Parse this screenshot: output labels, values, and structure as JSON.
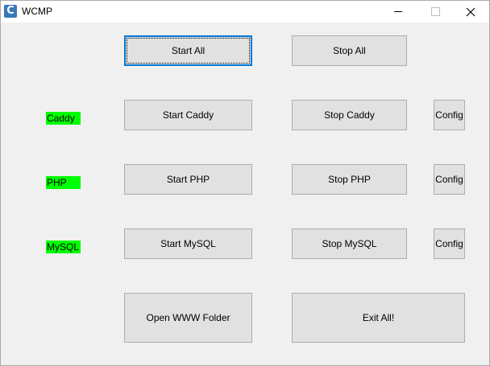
{
  "window": {
    "title": "WCMP",
    "icon_glyph": "C"
  },
  "colors": {
    "status_running": "#00ff00",
    "button_face": "#e1e1e1",
    "focus_border": "#0078d7"
  },
  "global": {
    "start_all": "Start All",
    "stop_all": "Stop All"
  },
  "services": [
    {
      "status": "Caddy",
      "start": "Start Caddy",
      "stop": "Stop Caddy",
      "config": "Config"
    },
    {
      "status": "PHP",
      "start": "Start PHP",
      "stop": "Stop PHP",
      "config": "Config"
    },
    {
      "status": "MySQL",
      "start": "Start MySQL",
      "stop": "Stop MySQL",
      "config": "Config"
    }
  ],
  "actions": {
    "open_www": "Open WWW Folder",
    "exit_all": "Exit All!"
  }
}
